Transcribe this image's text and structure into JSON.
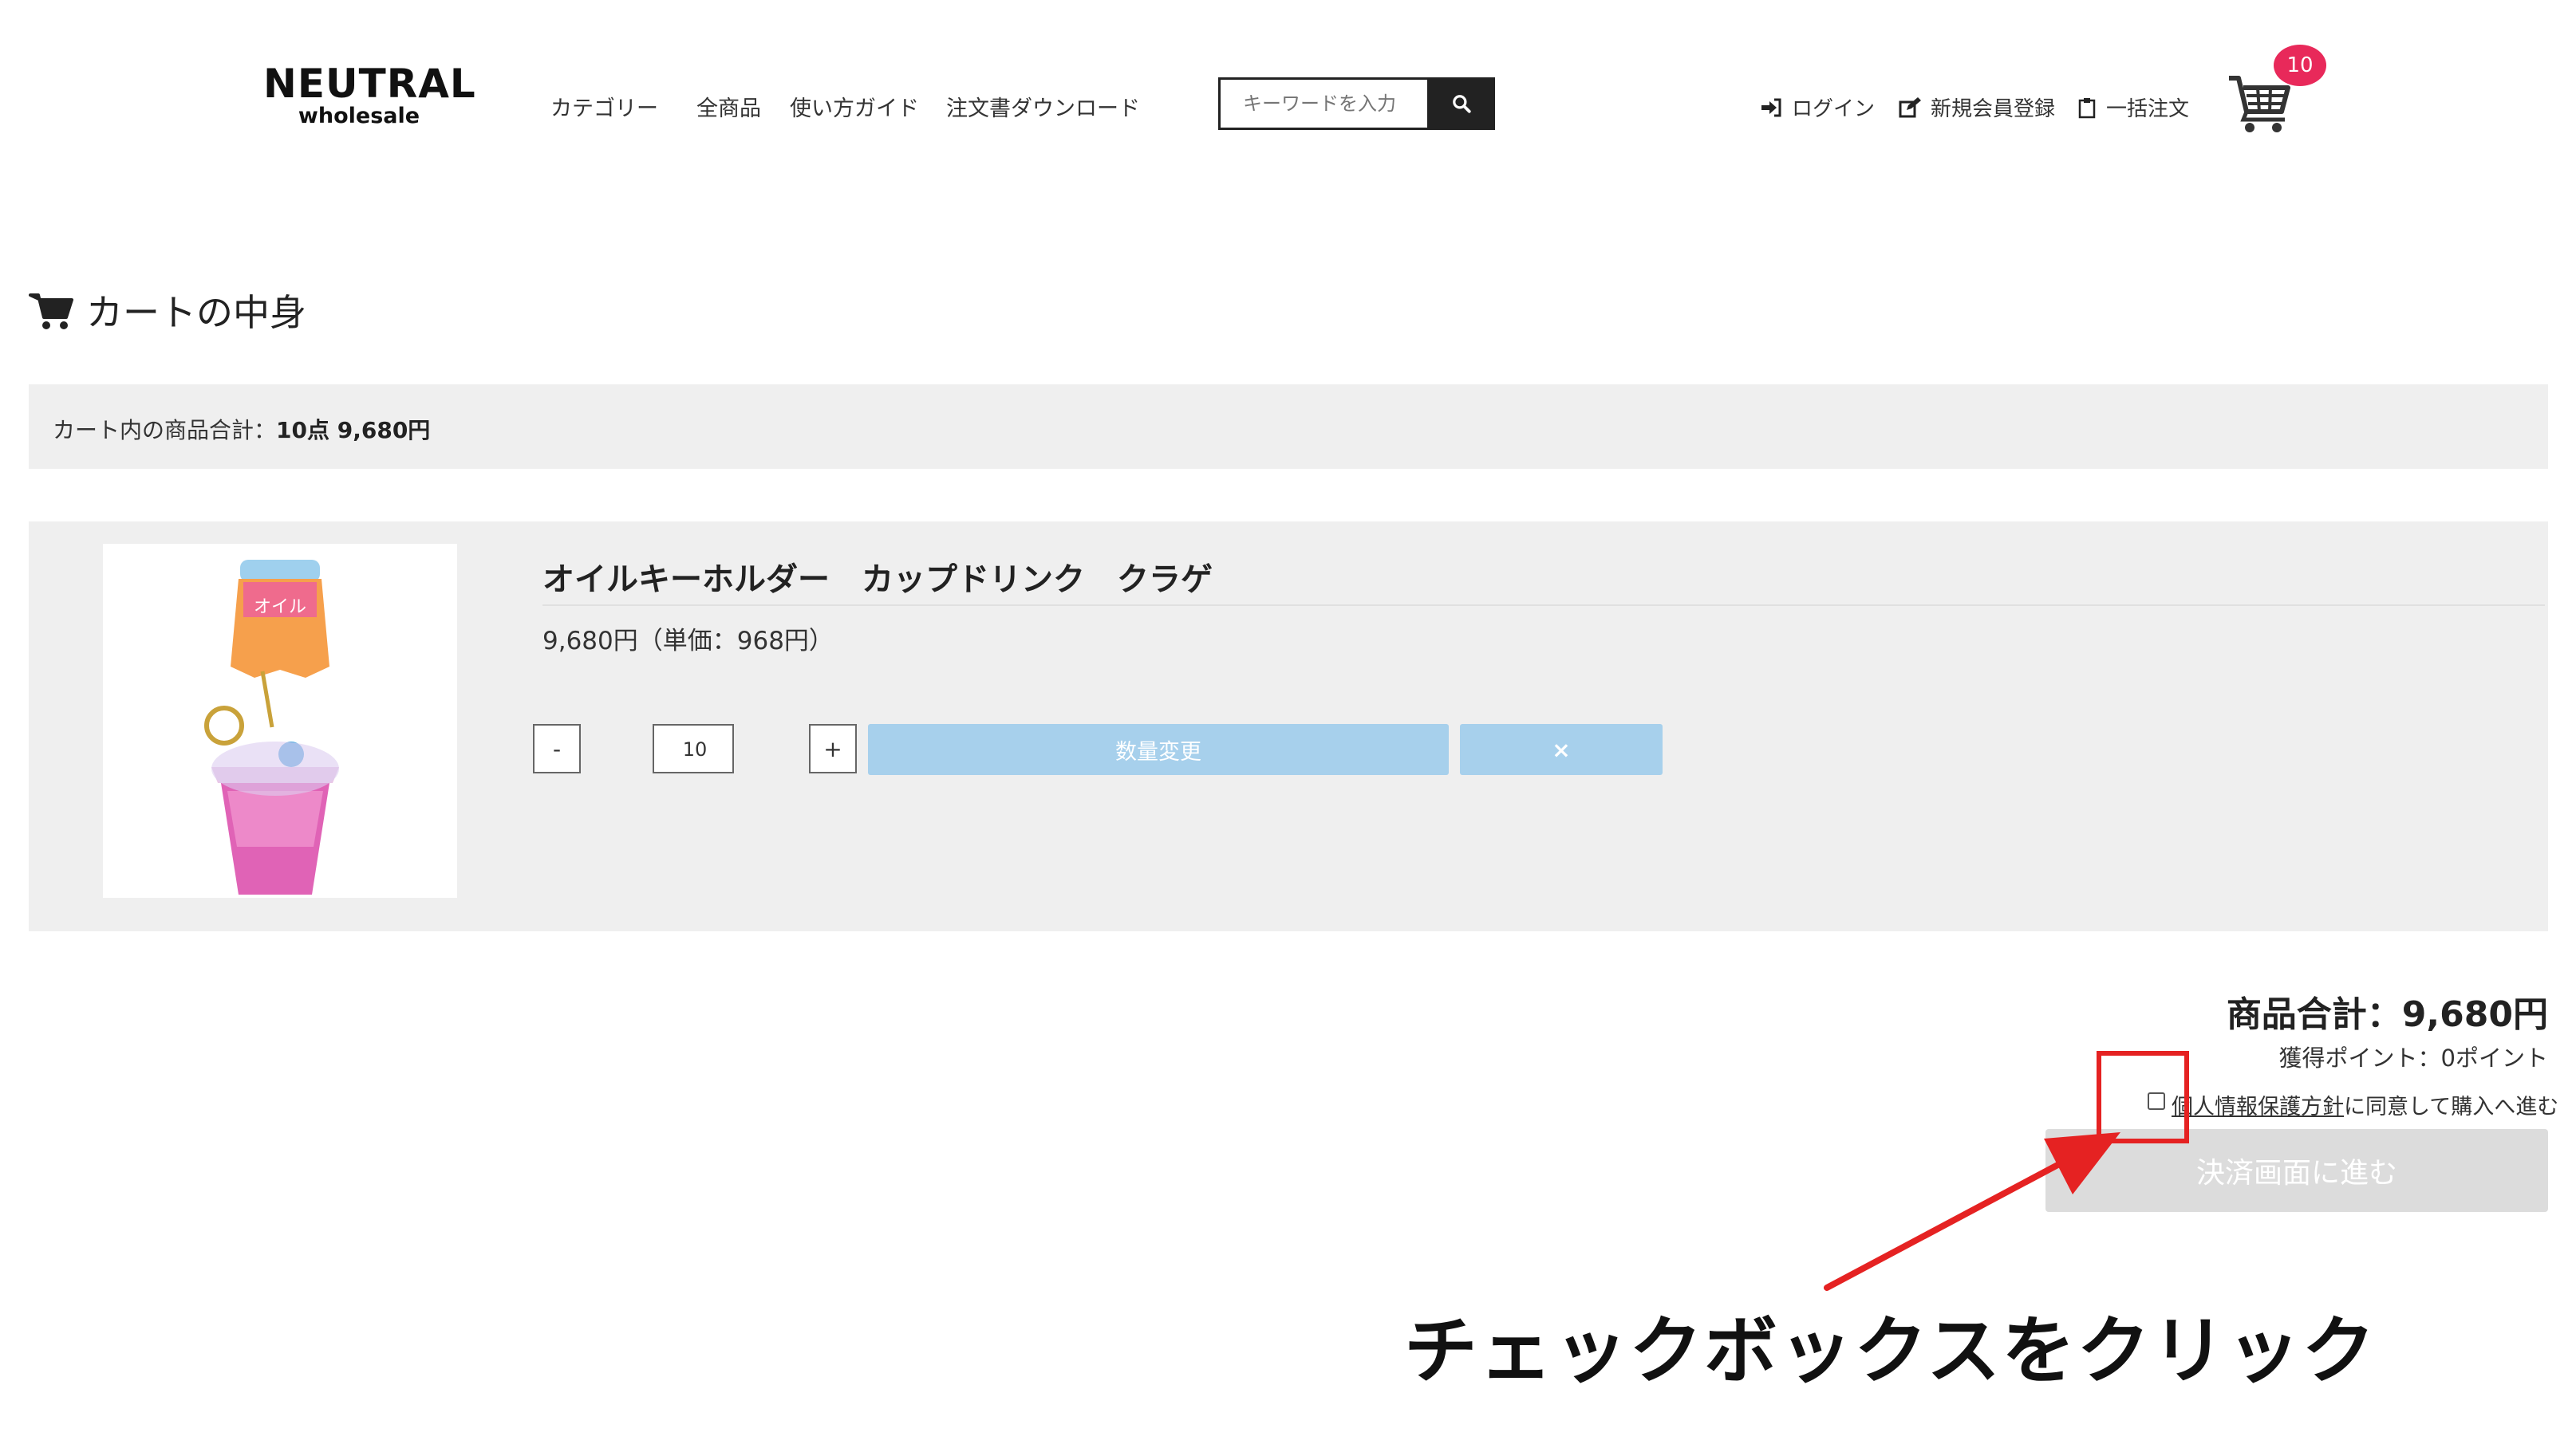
{
  "header": {
    "logo_main": "NEUTRAL",
    "logo_sub": "wholesale",
    "nav": [
      "カテゴリー",
      "全商品",
      "使い方ガイド",
      "注文書ダウンロード"
    ],
    "search_placeholder": "キーワードを入力",
    "login": "ログイン",
    "register": "新規会員登録",
    "bulk_order": "一括注文",
    "cart_count": "10"
  },
  "main": {
    "title": "カートの中身",
    "summary_prefix": "カート内の商品合計：",
    "summary_value": "10点  9,680円"
  },
  "item": {
    "name": "オイルキーホルダー　カップドリンク　クラゲ",
    "price": "9,680円（単価：968円）",
    "minus": "-",
    "quantity": "10",
    "plus": "+",
    "update_label": "数量変更",
    "remove_label": "×"
  },
  "totals": {
    "total": "商品合計：9,680円",
    "points": "獲得ポイント：0ポイント",
    "privacy_link": "個人情報保護方針",
    "privacy_suffix": "に同意して購入へ進む",
    "checkout": "決済画面に進む"
  },
  "annotation": {
    "callout": "チェックボックスをクリック",
    "color": "#e52222"
  },
  "colors": {
    "badge": "#e8295a",
    "button_light_blue": "#a7d0ec",
    "panel_gray": "#efefef",
    "disabled_button": "#dcdcdc"
  }
}
